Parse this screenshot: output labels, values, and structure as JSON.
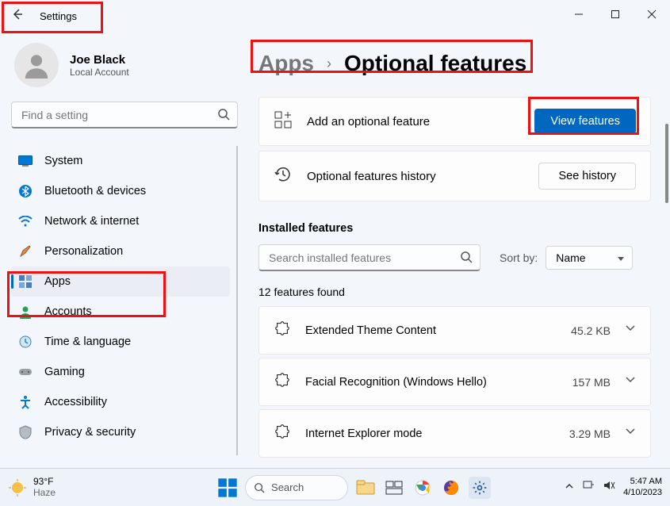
{
  "titlebar": {
    "title": "Settings"
  },
  "user": {
    "name": "Joe Black",
    "sub": "Local Account"
  },
  "search": {
    "placeholder": "Find a setting"
  },
  "nav": {
    "items": [
      {
        "label": "System"
      },
      {
        "label": "Bluetooth & devices"
      },
      {
        "label": "Network & internet"
      },
      {
        "label": "Personalization"
      },
      {
        "label": "Apps"
      },
      {
        "label": "Accounts"
      },
      {
        "label": "Time & language"
      },
      {
        "label": "Gaming"
      },
      {
        "label": "Accessibility"
      },
      {
        "label": "Privacy & security"
      }
    ]
  },
  "breadcrumb": {
    "parent": "Apps",
    "current": "Optional features"
  },
  "card_add": {
    "label": "Add an optional feature",
    "button": "View features"
  },
  "card_history": {
    "label": "Optional features history",
    "button": "See history"
  },
  "installed": {
    "header": "Installed features",
    "search_placeholder": "Search installed features",
    "sort_label": "Sort by:",
    "sort_value": "Name",
    "count": "12 features found",
    "items": [
      {
        "name": "Extended Theme Content",
        "size": "45.2 KB"
      },
      {
        "name": "Facial Recognition (Windows Hello)",
        "size": "157 MB"
      },
      {
        "name": "Internet Explorer mode",
        "size": "3.29 MB"
      }
    ]
  },
  "taskbar": {
    "weather_temp": "93°F",
    "weather_cond": "Haze",
    "search": "Search",
    "time": "5:47 AM",
    "date": "4/10/2023"
  }
}
